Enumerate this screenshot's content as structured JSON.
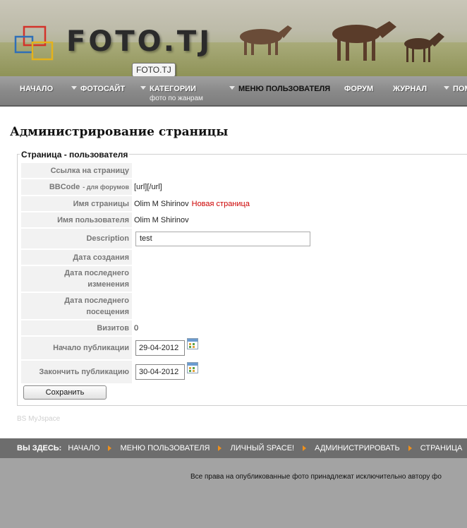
{
  "header": {
    "logo_text": "FOTO.TJ",
    "tooltip": "FOTO.TJ"
  },
  "nav": {
    "items": [
      {
        "label": "НАЧАЛО",
        "caret": false
      },
      {
        "label": "ФОТОСАЙТ",
        "caret": true
      },
      {
        "label": "КАТЕГОРИИ",
        "caret": true,
        "sub": "фото по жанрам"
      },
      {
        "label": "МЕНЮ ПОЛЬЗОВАТЕЛЯ",
        "caret": true,
        "active": true
      },
      {
        "label": "ФОРУМ",
        "caret": false
      },
      {
        "label": "ЖУРНАЛ",
        "caret": false
      },
      {
        "label": "ПОМ",
        "caret": true
      }
    ]
  },
  "main": {
    "title": "Администрирование страницы",
    "legend": "Страница - пользователя",
    "fields": {
      "link_label": "Ссылка на страницу",
      "bbcode_label": "BBCode",
      "bbcode_small": "- для форумов",
      "bbcode_value": "[url][/url]",
      "page_name_label": "Имя страницы",
      "page_name_value": "Olim M Shirinov",
      "page_name_link": "Новая страница",
      "user_name_label": "Имя пользователя",
      "user_name_value": "Olim M Shirinov",
      "description_label": "Description",
      "description_value": "test",
      "created_label": "Дата создания",
      "modified_label": "Дата последнего изменения",
      "visited_label": "Дата последнего посещения",
      "visits_label": "Визитов",
      "visits_value": "0",
      "pub_start_label": "Начало публикации",
      "pub_start_value": "29-04-2012",
      "pub_end_label": "Закончить публикацию",
      "pub_end_value": "30-04-2012"
    },
    "save_label": "Сохранить",
    "footer_note": "BS MyJspace"
  },
  "breadcrumb": {
    "lead": "ВЫ ЗДЕСЬ:",
    "items": [
      "НАЧАЛО",
      "МЕНЮ ПОЛЬЗОВАТЕЛЯ",
      "ЛИЧНЫЙ SPACE!",
      "АДМИНИСТРИРОВАТЬ",
      "СТРАНИЦА"
    ]
  },
  "footer": {
    "copyright": "Все права на опубликованные фото принадлежат исключительно автору фо"
  },
  "colors": {
    "link_red": "#cc0000",
    "crumb_arrow": "#f0901a",
    "nav_gray": "#8a8a8a"
  }
}
